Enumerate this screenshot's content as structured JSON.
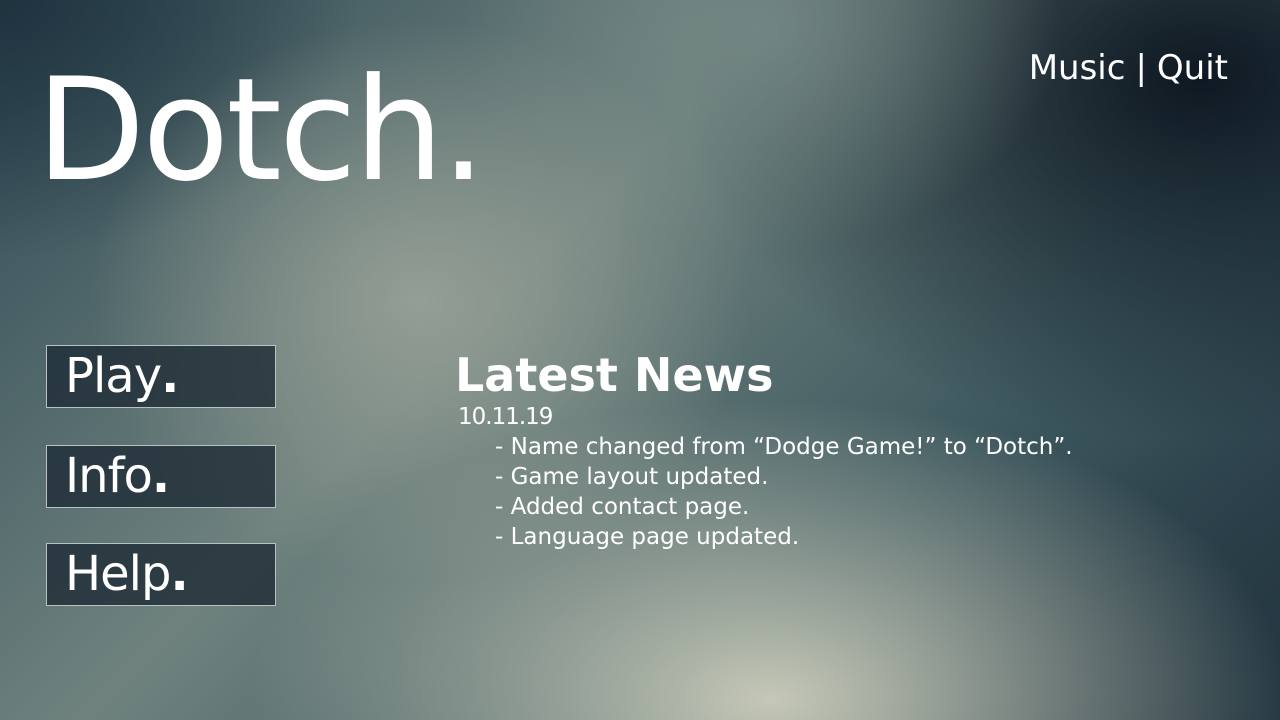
{
  "title": "Dotch",
  "title_dot": ".",
  "top_menu": {
    "music_label": "Music",
    "separator": "|",
    "quit_label": "Quit"
  },
  "main_menu": [
    {
      "label": "Play",
      "dot": "."
    },
    {
      "label": "Info",
      "dot": "."
    },
    {
      "label": "Help",
      "dot": "."
    }
  ],
  "news": {
    "heading": "Latest News",
    "date": "10.11.19",
    "items": [
      "- Name changed from “Dodge Game!” to “Dotch”.",
      "- Game layout updated.",
      "- Added contact page.",
      "- Language page updated."
    ]
  }
}
